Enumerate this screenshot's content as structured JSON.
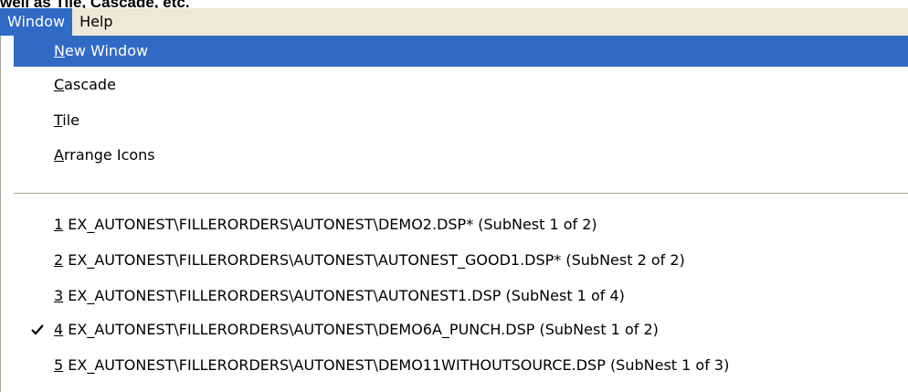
{
  "top_text": "well as Tile, Cascade, etc.",
  "menubar": {
    "items": [
      "Window",
      "Help"
    ],
    "active": "Window"
  },
  "menu": {
    "actions": [
      {
        "mnemonic": "N",
        "rest": "ew Window",
        "highlighted": true
      },
      {
        "mnemonic": "C",
        "rest": "ascade",
        "highlighted": false
      },
      {
        "mnemonic": "T",
        "rest": "ile",
        "highlighted": false
      },
      {
        "mnemonic": "A",
        "rest": "rrange Icons",
        "highlighted": false
      }
    ],
    "windows": [
      {
        "mnemonic": "1",
        "rest": " EX_AUTONEST\\FILLERORDERS\\AUTONEST\\DEMO2.DSP* (SubNest 1 of 2)",
        "checked": false
      },
      {
        "mnemonic": "2",
        "rest": " EX_AUTONEST\\FILLERORDERS\\AUTONEST\\AUTONEST_GOOD1.DSP* (SubNest 2 of 2)",
        "checked": false
      },
      {
        "mnemonic": "3",
        "rest": " EX_AUTONEST\\FILLERORDERS\\AUTONEST\\AUTONEST1.DSP (SubNest 1 of 4)",
        "checked": false
      },
      {
        "mnemonic": "4",
        "rest": " EX_AUTONEST\\FILLERORDERS\\AUTONEST\\DEMO6A_PUNCH.DSP (SubNest 1 of 2)",
        "checked": true
      },
      {
        "mnemonic": "5",
        "rest": " EX_AUTONEST\\FILLERORDERS\\AUTONEST\\DEMO11WITHOUTSOURCE.DSP (SubNest 1 of 3)",
        "checked": false
      }
    ]
  },
  "colors": {
    "highlight": "#316ac5",
    "menubar_bg": "#ece9d8",
    "separator": "#aca899"
  }
}
